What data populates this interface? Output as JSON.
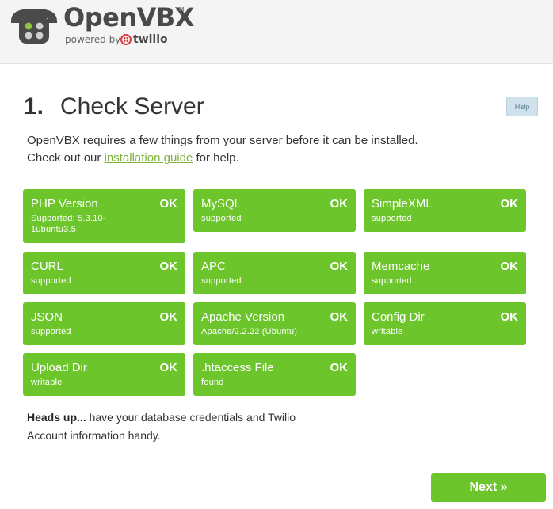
{
  "header": {
    "brand": "OpenVBX",
    "trademark": "TM",
    "powered_by": "powered by",
    "partner": "twilio"
  },
  "step": {
    "number": "1.",
    "title": "Check Server",
    "help_label": "Help"
  },
  "intro": {
    "line1": "OpenVBX requires a few things from your server before it can be installed.",
    "line2_prefix": "Check out our ",
    "link_text": "installation guide",
    "line2_suffix": " for help."
  },
  "checks": [
    {
      "name": "PHP Version",
      "status": "OK",
      "detail": "Supported: 5.3.10-1ubuntu3.5"
    },
    {
      "name": "MySQL",
      "status": "OK",
      "detail": "supported"
    },
    {
      "name": "SimpleXML",
      "status": "OK",
      "detail": "supported"
    },
    {
      "name": "CURL",
      "status": "OK",
      "detail": "supported"
    },
    {
      "name": "APC",
      "status": "OK",
      "detail": "supported"
    },
    {
      "name": "Memcache",
      "status": "OK",
      "detail": "supported"
    },
    {
      "name": "JSON",
      "status": "OK",
      "detail": "supported"
    },
    {
      "name": "Apache Version",
      "status": "OK",
      "detail": "Apache/2.2.22 (Ubuntu)"
    },
    {
      "name": "Config Dir",
      "status": "OK",
      "detail": "writable"
    },
    {
      "name": "Upload Dir",
      "status": "OK",
      "detail": "writable"
    },
    {
      "name": ".htaccess File",
      "status": "OK",
      "detail": "found"
    }
  ],
  "headsup": {
    "bold": "Heads up...",
    "text": " have your database credentials and Twilio Account information handy."
  },
  "next_label": "Next »",
  "colors": {
    "check_green": "#6cc52b",
    "link_green": "#7fb23a",
    "header_bg": "#f4f4f4",
    "help_bg": "#cfe2ec"
  }
}
